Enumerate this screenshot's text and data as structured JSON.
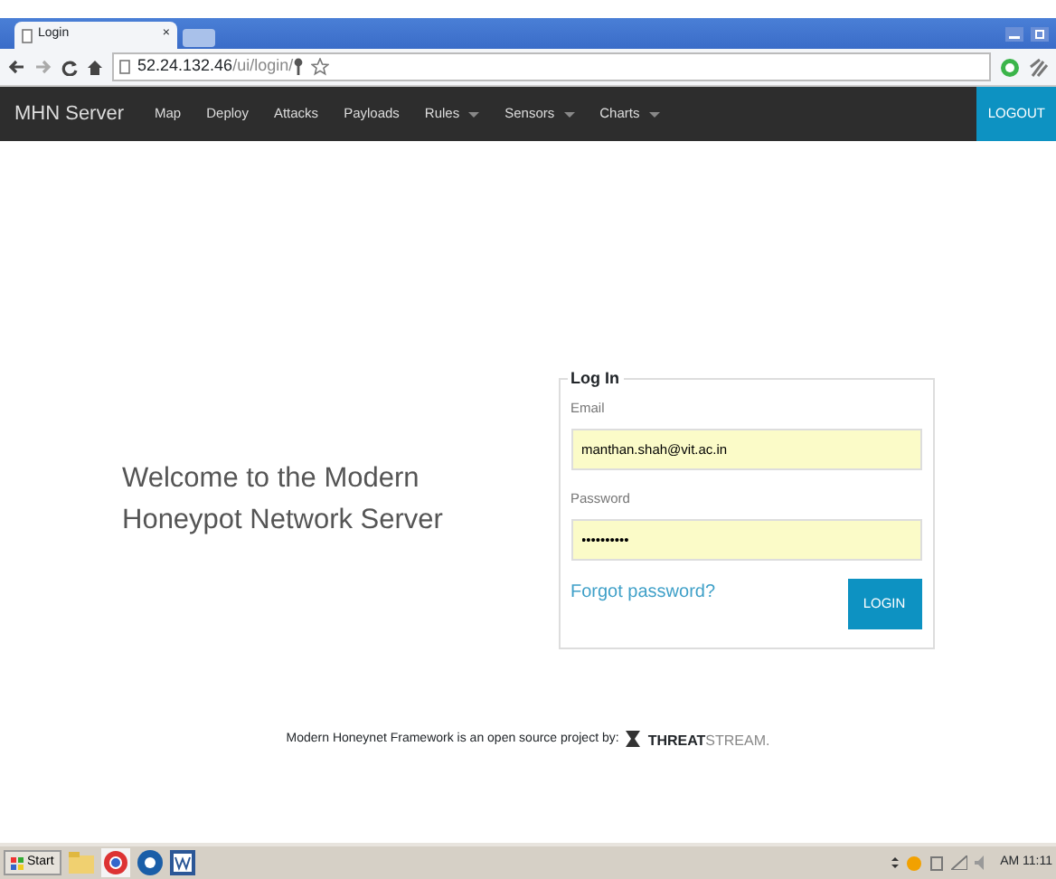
{
  "browser": {
    "tab_title": "Login",
    "close": "×",
    "url_host": "52.24.132.46",
    "url_path": "/ui/login/"
  },
  "navbar": {
    "brand": "MHN Server",
    "items": [
      {
        "label": "Map",
        "dropdown": false
      },
      {
        "label": "Deploy",
        "dropdown": false
      },
      {
        "label": "Attacks",
        "dropdown": false
      },
      {
        "label": "Payloads",
        "dropdown": false
      },
      {
        "label": "Rules",
        "dropdown": true
      },
      {
        "label": "Sensors",
        "dropdown": true
      },
      {
        "label": "Charts",
        "dropdown": true
      }
    ],
    "logout": "LOGOUT"
  },
  "welcome": "Welcome to the Modern Honeypot Network Server",
  "login": {
    "legend": "Log In",
    "email_label": "Email",
    "email_value": "manthan.shah@vit.ac.in",
    "password_label": "Password",
    "password_value": "••••••••••",
    "forgot": "Forgot password?",
    "button": "LOGIN"
  },
  "footer": {
    "text": "Modern Honeynet Framework is an open source project by:",
    "logo_bold": "THREAT",
    "logo_light": "STREAM."
  },
  "taskbar": {
    "start": "Start",
    "clock": "AM 11:11"
  }
}
